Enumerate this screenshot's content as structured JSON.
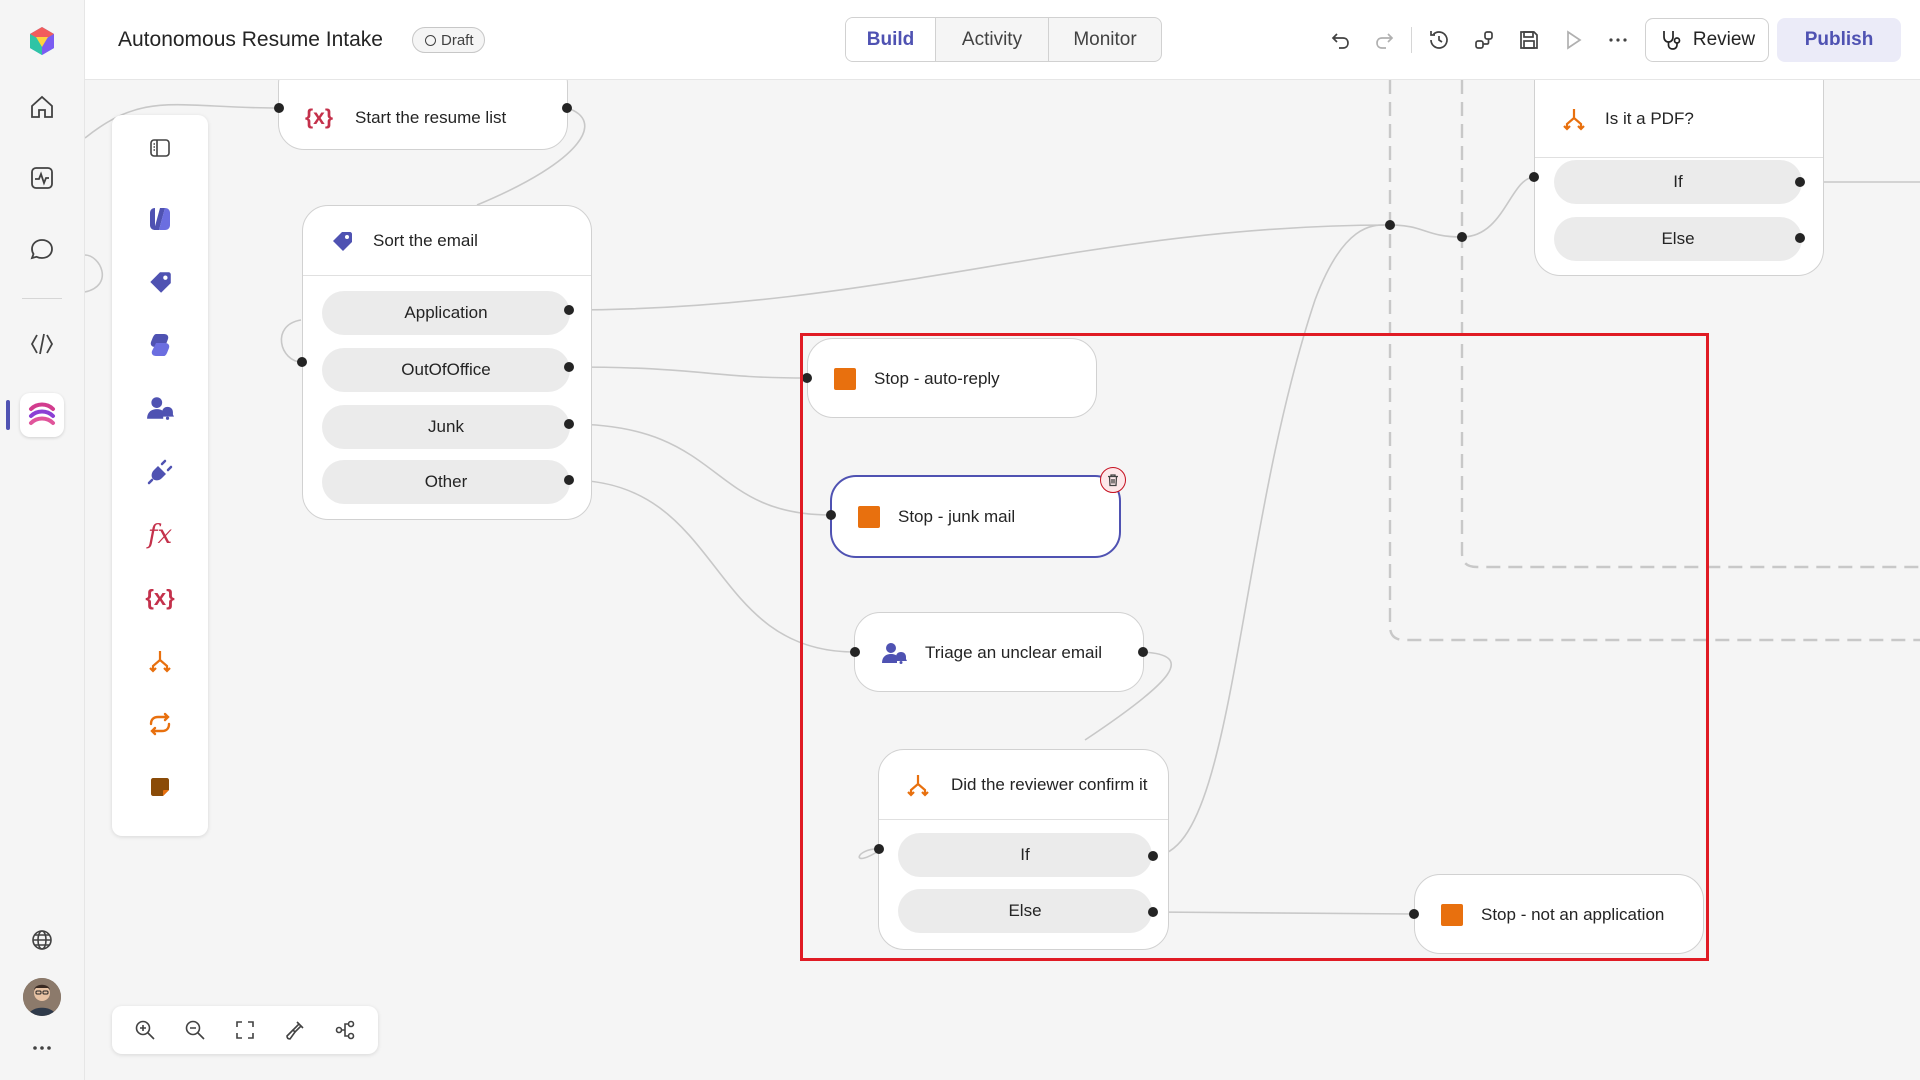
{
  "app": {
    "title": "Autonomous Resume Intake",
    "status_badge": "Draft"
  },
  "tabs": [
    {
      "label": "Build",
      "active": true
    },
    {
      "label": "Activity",
      "active": false
    },
    {
      "label": "Monitor",
      "active": false
    }
  ],
  "toolbar": {
    "review_label": "Review",
    "publish_label": "Publish",
    "icons": [
      "undo-icon",
      "redo-icon",
      "history-icon",
      "connections-icon",
      "save-icon",
      "play-icon",
      "more-icon"
    ]
  },
  "rail": {
    "items": [
      "app-logo",
      "home-icon",
      "activity-icon",
      "chat-icon",
      "code-icon",
      "flow-icon",
      "globe-icon",
      "avatar",
      "more-icon"
    ]
  },
  "palette": {
    "items": [
      "panel-toggle-icon",
      "agent-icon",
      "tag-icon",
      "copilot-icon",
      "human-review-icon",
      "connector-icon",
      "formula-icon",
      "variable-icon",
      "condition-icon",
      "loop-icon",
      "note-icon"
    ]
  },
  "nodes": {
    "start_resume_list": {
      "label": "Start the resume list"
    },
    "sort_email": {
      "label": "Sort the email",
      "branches": [
        "Application",
        "OutOfOffice",
        "Junk",
        "Other"
      ]
    },
    "is_pdf": {
      "label": "Is it a PDF?",
      "branches": [
        "If",
        "Else"
      ]
    },
    "stop_auto_reply": {
      "label": "Stop - auto-reply"
    },
    "stop_junk_mail": {
      "label": "Stop - junk mail"
    },
    "triage_unclear": {
      "label": "Triage an unclear email"
    },
    "reviewer_confirm": {
      "label": "Did the reviewer confirm it",
      "branches": [
        "If",
        "Else"
      ]
    },
    "stop_not_application": {
      "label": "Stop - not an application"
    }
  },
  "zoombar": {
    "icons": [
      "zoom-in-icon",
      "zoom-out-icon",
      "fit-view-icon",
      "clean-up-icon",
      "layout-icon"
    ]
  },
  "colors": {
    "accent": "#4f52b2",
    "stop_orange": "#e8700e",
    "highlight_red": "#e01b24",
    "variable_red": "#c4314b"
  }
}
